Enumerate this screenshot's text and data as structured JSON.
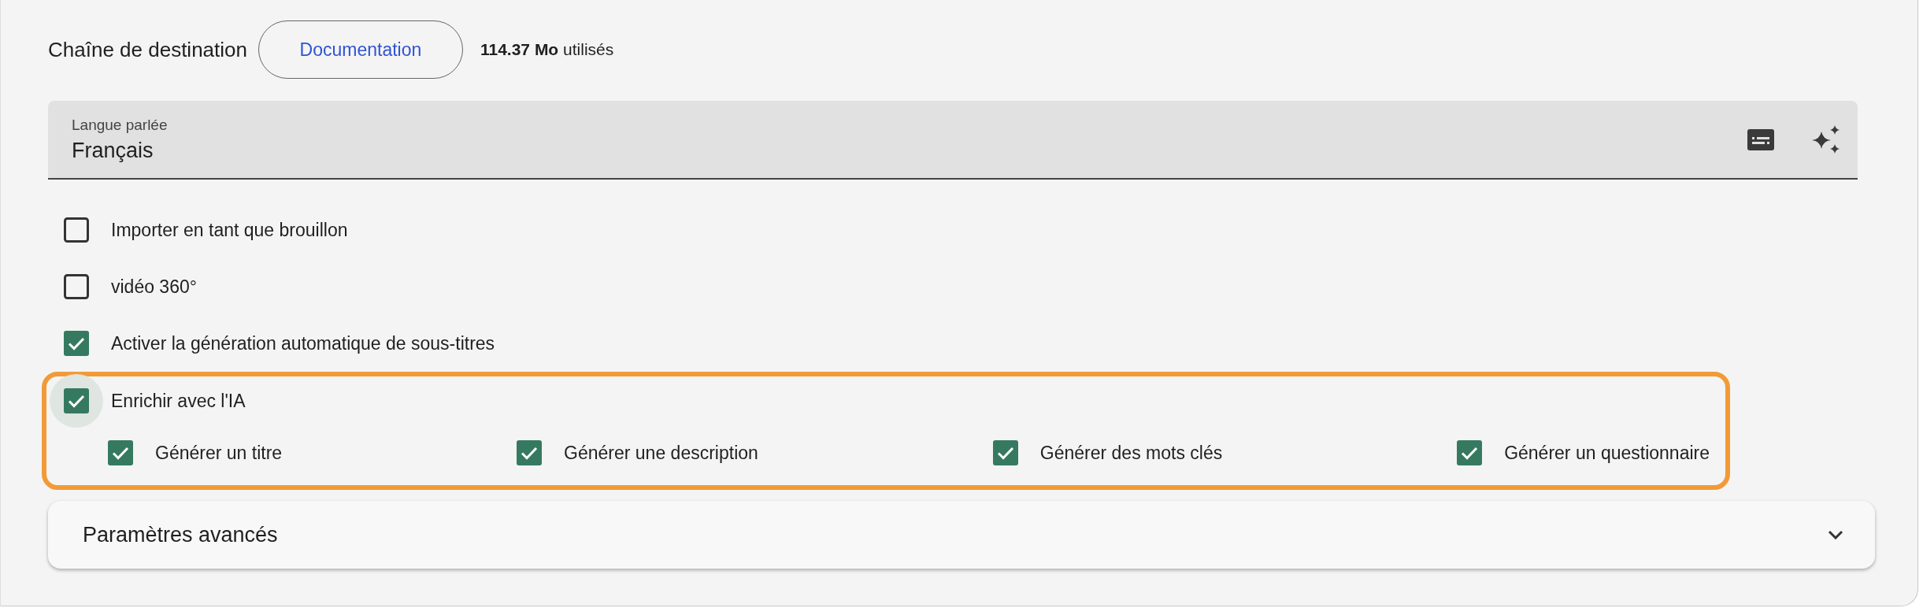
{
  "header": {
    "title": "Chaîne de destination",
    "doc_button": "Documentation",
    "usage": "**114.37 Mo** utilisés"
  },
  "language_field": {
    "label": "Langue parlée",
    "value": "Français"
  },
  "options": [
    {
      "label": "Importer en tant que brouillon",
      "checked": false
    },
    {
      "label": "vidéo 360°",
      "checked": false
    },
    {
      "label": "Activer la génération automatique de sous-titres",
      "checked": true
    }
  ],
  "ai_group": {
    "highlighted": true,
    "label": "Enrichir avec l'IA",
    "checked": true,
    "focused": true,
    "items": [
      {
        "label": "Générer un titre",
        "checked": true
      },
      {
        "label": "Générer une description",
        "checked": true
      },
      {
        "label": "Générer des mots clés",
        "checked": true
      },
      {
        "label": "Générer un questionnaire",
        "checked": true
      }
    ]
  },
  "accordion": {
    "title": "Paramètres avancés",
    "expanded": false
  }
}
